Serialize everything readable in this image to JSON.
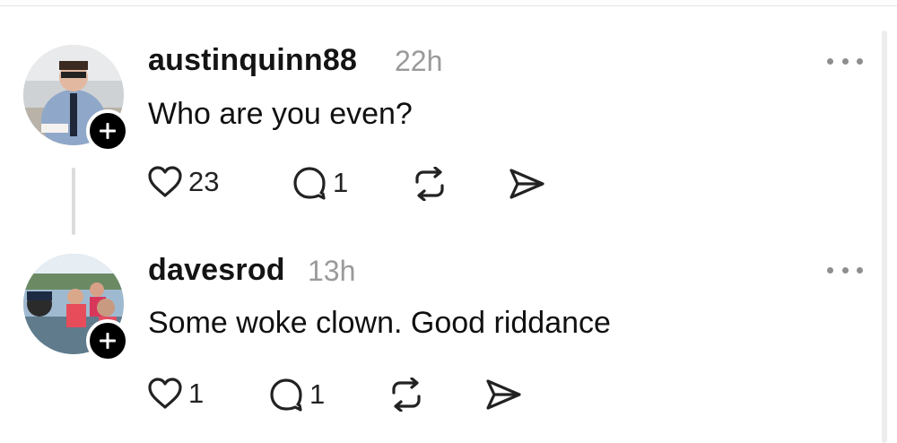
{
  "posts": [
    {
      "username": "austinquinn88",
      "time": "22h",
      "text": "Who are you even?",
      "likes": "23",
      "replies": "1"
    },
    {
      "username": "davesrod",
      "time": "13h",
      "text": "Some woke clown. Good riddance",
      "likes": "1",
      "replies": "1"
    }
  ],
  "icons": {
    "like": "heart-icon",
    "reply": "comment-icon",
    "repost": "repost-icon",
    "share": "send-icon",
    "more": "more-icon",
    "follow": "plus-icon"
  },
  "colors": {
    "text": "#101010",
    "muted": "#9a9a9a",
    "badge": "#000000"
  }
}
